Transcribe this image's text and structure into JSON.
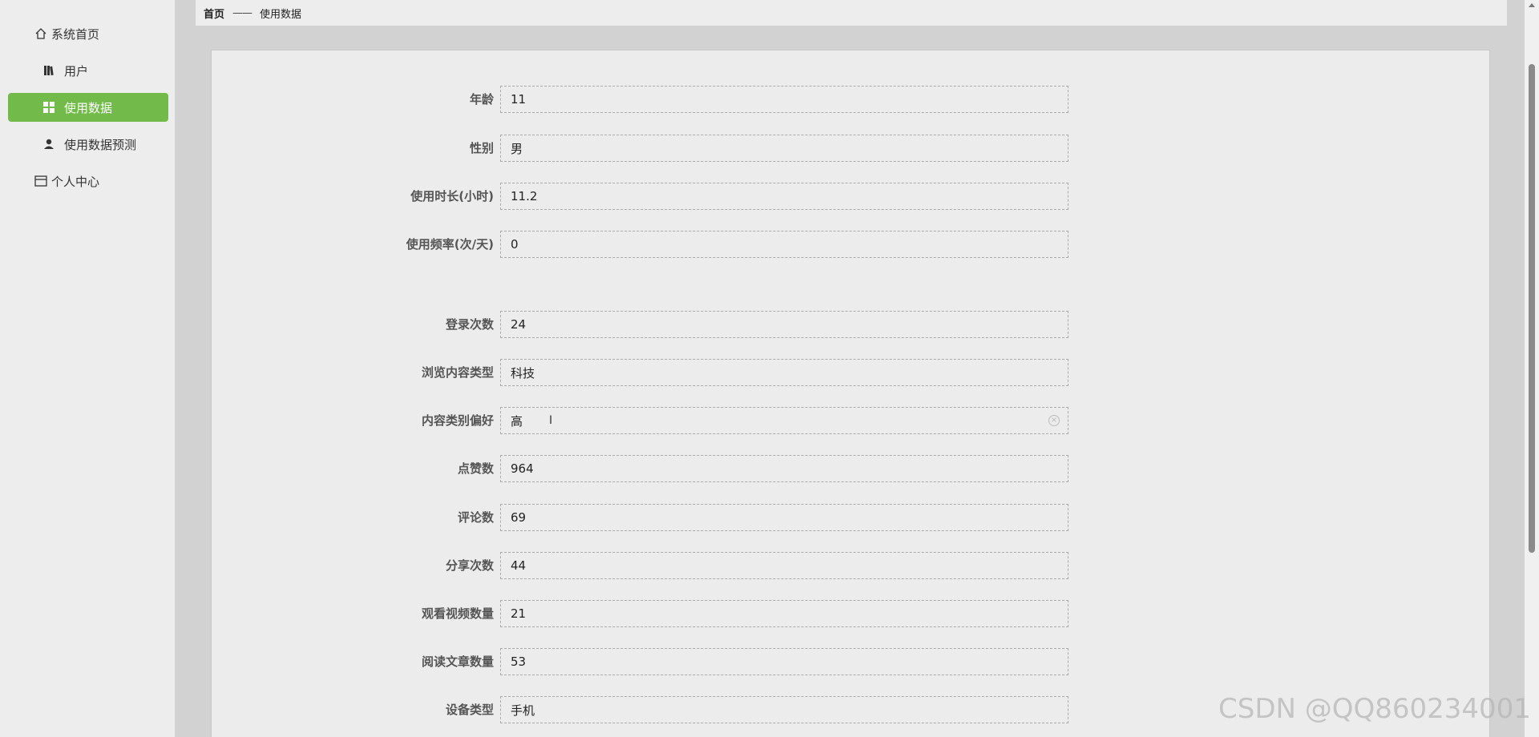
{
  "sidebar": {
    "items": [
      {
        "label": "系统首页",
        "icon": "home-icon"
      },
      {
        "label": "用户",
        "icon": "books-icon"
      },
      {
        "label": "使用数据",
        "icon": "grid-icon",
        "active": true
      },
      {
        "label": "使用数据预测",
        "icon": "user-icon"
      },
      {
        "label": "个人中心",
        "icon": "window-icon"
      }
    ]
  },
  "breadcrumb": {
    "home": "首页",
    "separator": "——",
    "current": "使用数据"
  },
  "form": {
    "fields": [
      {
        "label": "年龄",
        "value": "11"
      },
      {
        "label": "性别",
        "value": "男"
      },
      {
        "label": "使用时长(小时)",
        "value": "11.2"
      },
      {
        "label": "使用频率(次/天)",
        "value": "0"
      },
      {
        "label": "登录次数",
        "value": "24"
      },
      {
        "label": "浏览内容类型",
        "value": "科技"
      },
      {
        "label": "内容类别偏好",
        "value": "高"
      },
      {
        "label": "点赞数",
        "value": "964"
      },
      {
        "label": "评论数",
        "value": "69"
      },
      {
        "label": "分享次数",
        "value": "44"
      },
      {
        "label": "观看视频数量",
        "value": "21"
      },
      {
        "label": "阅读文章数量",
        "value": "53"
      },
      {
        "label": "设备类型",
        "value": "手机"
      }
    ]
  },
  "watermark": "CSDN @QQ860234001",
  "colors": {
    "accent": "#72bb4a"
  }
}
